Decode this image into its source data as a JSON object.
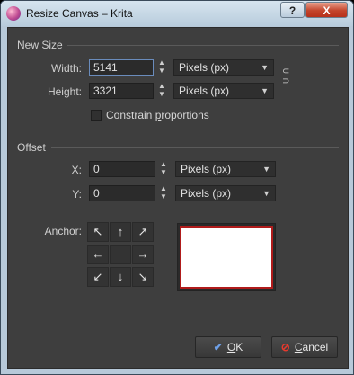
{
  "window": {
    "title": "Resize Canvas – Krita",
    "help_label": "?",
    "close_label": "X"
  },
  "new_size": {
    "section_label": "New Size",
    "width_label": "Width:",
    "width_value": "5141",
    "width_unit": "Pixels (px)",
    "height_label": "Height:",
    "height_value": "3321",
    "height_unit": "Pixels (px)",
    "constrain_label_pre": "Constrain ",
    "constrain_label_u": "p",
    "constrain_label_post": "roportions",
    "constrain_checked": false
  },
  "offset": {
    "section_label": "Offset",
    "x_label": "X:",
    "x_value": "0",
    "x_unit": "Pixels (px)",
    "y_label": "Y:",
    "y_value": "0",
    "y_unit": "Pixels (px)"
  },
  "anchor": {
    "label": "Anchor:",
    "arrows": [
      "↖",
      "↑",
      "↗",
      "←",
      "",
      "→",
      "↙",
      "↓",
      "↘"
    ]
  },
  "buttons": {
    "ok_u": "O",
    "ok_rest": "K",
    "cancel_u": "C",
    "cancel_rest": "ancel"
  },
  "icons": {
    "app": "krita-icon",
    "ok": "checkmark-icon",
    "cancel": "cancel-icon"
  }
}
